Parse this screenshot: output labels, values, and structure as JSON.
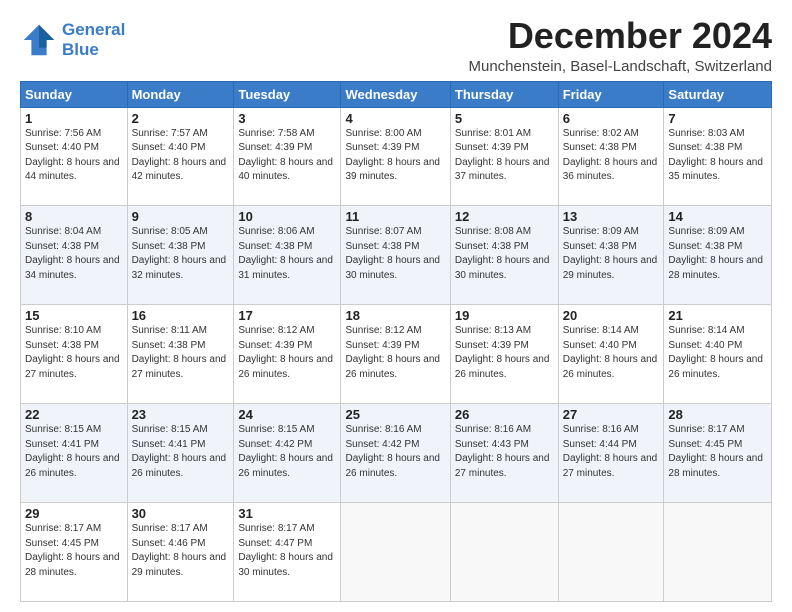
{
  "logo": {
    "line1": "General",
    "line2": "Blue"
  },
  "title": "December 2024",
  "subtitle": "Munchenstein, Basel-Landschaft, Switzerland",
  "weekdays": [
    "Sunday",
    "Monday",
    "Tuesday",
    "Wednesday",
    "Thursday",
    "Friday",
    "Saturday"
  ],
  "weeks": [
    [
      {
        "day": "1",
        "sunrise": "7:56 AM",
        "sunset": "4:40 PM",
        "daylight": "8 hours and 44 minutes."
      },
      {
        "day": "2",
        "sunrise": "7:57 AM",
        "sunset": "4:40 PM",
        "daylight": "8 hours and 42 minutes."
      },
      {
        "day": "3",
        "sunrise": "7:58 AM",
        "sunset": "4:39 PM",
        "daylight": "8 hours and 40 minutes."
      },
      {
        "day": "4",
        "sunrise": "8:00 AM",
        "sunset": "4:39 PM",
        "daylight": "8 hours and 39 minutes."
      },
      {
        "day": "5",
        "sunrise": "8:01 AM",
        "sunset": "4:39 PM",
        "daylight": "8 hours and 37 minutes."
      },
      {
        "day": "6",
        "sunrise": "8:02 AM",
        "sunset": "4:38 PM",
        "daylight": "8 hours and 36 minutes."
      },
      {
        "day": "7",
        "sunrise": "8:03 AM",
        "sunset": "4:38 PM",
        "daylight": "8 hours and 35 minutes."
      }
    ],
    [
      {
        "day": "8",
        "sunrise": "8:04 AM",
        "sunset": "4:38 PM",
        "daylight": "8 hours and 34 minutes."
      },
      {
        "day": "9",
        "sunrise": "8:05 AM",
        "sunset": "4:38 PM",
        "daylight": "8 hours and 32 minutes."
      },
      {
        "day": "10",
        "sunrise": "8:06 AM",
        "sunset": "4:38 PM",
        "daylight": "8 hours and 31 minutes."
      },
      {
        "day": "11",
        "sunrise": "8:07 AM",
        "sunset": "4:38 PM",
        "daylight": "8 hours and 30 minutes."
      },
      {
        "day": "12",
        "sunrise": "8:08 AM",
        "sunset": "4:38 PM",
        "daylight": "8 hours and 30 minutes."
      },
      {
        "day": "13",
        "sunrise": "8:09 AM",
        "sunset": "4:38 PM",
        "daylight": "8 hours and 29 minutes."
      },
      {
        "day": "14",
        "sunrise": "8:09 AM",
        "sunset": "4:38 PM",
        "daylight": "8 hours and 28 minutes."
      }
    ],
    [
      {
        "day": "15",
        "sunrise": "8:10 AM",
        "sunset": "4:38 PM",
        "daylight": "8 hours and 27 minutes."
      },
      {
        "day": "16",
        "sunrise": "8:11 AM",
        "sunset": "4:38 PM",
        "daylight": "8 hours and 27 minutes."
      },
      {
        "day": "17",
        "sunrise": "8:12 AM",
        "sunset": "4:39 PM",
        "daylight": "8 hours and 26 minutes."
      },
      {
        "day": "18",
        "sunrise": "8:12 AM",
        "sunset": "4:39 PM",
        "daylight": "8 hours and 26 minutes."
      },
      {
        "day": "19",
        "sunrise": "8:13 AM",
        "sunset": "4:39 PM",
        "daylight": "8 hours and 26 minutes."
      },
      {
        "day": "20",
        "sunrise": "8:14 AM",
        "sunset": "4:40 PM",
        "daylight": "8 hours and 26 minutes."
      },
      {
        "day": "21",
        "sunrise": "8:14 AM",
        "sunset": "4:40 PM",
        "daylight": "8 hours and 26 minutes."
      }
    ],
    [
      {
        "day": "22",
        "sunrise": "8:15 AM",
        "sunset": "4:41 PM",
        "daylight": "8 hours and 26 minutes."
      },
      {
        "day": "23",
        "sunrise": "8:15 AM",
        "sunset": "4:41 PM",
        "daylight": "8 hours and 26 minutes."
      },
      {
        "day": "24",
        "sunrise": "8:15 AM",
        "sunset": "4:42 PM",
        "daylight": "8 hours and 26 minutes."
      },
      {
        "day": "25",
        "sunrise": "8:16 AM",
        "sunset": "4:42 PM",
        "daylight": "8 hours and 26 minutes."
      },
      {
        "day": "26",
        "sunrise": "8:16 AM",
        "sunset": "4:43 PM",
        "daylight": "8 hours and 27 minutes."
      },
      {
        "day": "27",
        "sunrise": "8:16 AM",
        "sunset": "4:44 PM",
        "daylight": "8 hours and 27 minutes."
      },
      {
        "day": "28",
        "sunrise": "8:17 AM",
        "sunset": "4:45 PM",
        "daylight": "8 hours and 28 minutes."
      }
    ],
    [
      {
        "day": "29",
        "sunrise": "8:17 AM",
        "sunset": "4:45 PM",
        "daylight": "8 hours and 28 minutes."
      },
      {
        "day": "30",
        "sunrise": "8:17 AM",
        "sunset": "4:46 PM",
        "daylight": "8 hours and 29 minutes."
      },
      {
        "day": "31",
        "sunrise": "8:17 AM",
        "sunset": "4:47 PM",
        "daylight": "8 hours and 30 minutes."
      },
      null,
      null,
      null,
      null
    ]
  ]
}
